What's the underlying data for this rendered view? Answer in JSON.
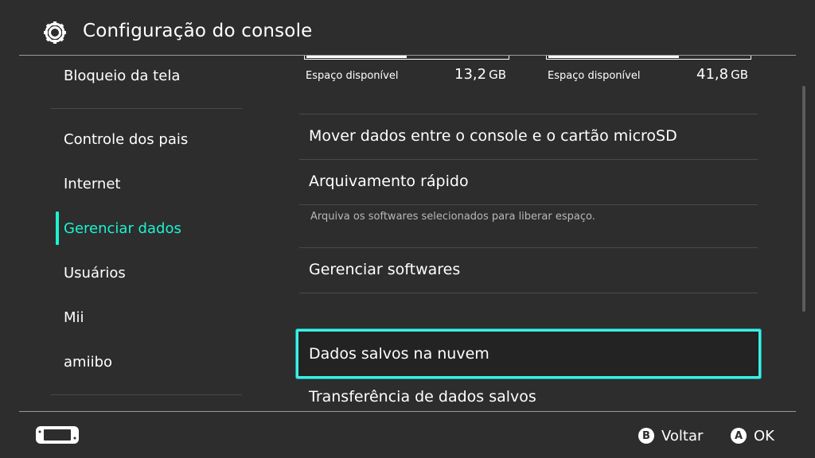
{
  "header": {
    "title": "Configuração do console",
    "icon": "gear-icon"
  },
  "sidebar": {
    "items": [
      {
        "label": "Bloqueio da tela",
        "active": false
      },
      {
        "label": "Controle dos pais",
        "active": false
      },
      {
        "label": "Internet",
        "active": false
      },
      {
        "label": "Gerenciar dados",
        "active": true
      },
      {
        "label": "Usuários",
        "active": false
      },
      {
        "label": "Mii",
        "active": false
      },
      {
        "label": "amiibo",
        "active": false
      }
    ]
  },
  "main": {
    "storage": [
      {
        "label": "Espaço disponível",
        "value": "13,2",
        "unit": "GB",
        "used_fraction": 0.5
      },
      {
        "label": "Espaço disponível",
        "value": "41,8",
        "unit": "GB",
        "used_fraction": 0.65
      }
    ],
    "items": [
      {
        "label": "Mover dados entre o console e o cartão microSD"
      },
      {
        "label": "Arquivamento rápido",
        "description": "Arquiva os softwares selecionados para liberar espaço."
      },
      {
        "label": "Gerenciar softwares"
      },
      {
        "label": "Dados salvos na nuvem",
        "selected": true
      },
      {
        "label": "Transferência de dados salvos"
      }
    ]
  },
  "footer": {
    "back": {
      "button": "B",
      "label": "Voltar"
    },
    "ok": {
      "button": "A",
      "label": "OK"
    }
  },
  "colors": {
    "background": "#2d2d2d",
    "accent": "#1cf3d0",
    "selection_border": "#3cf0e4"
  }
}
